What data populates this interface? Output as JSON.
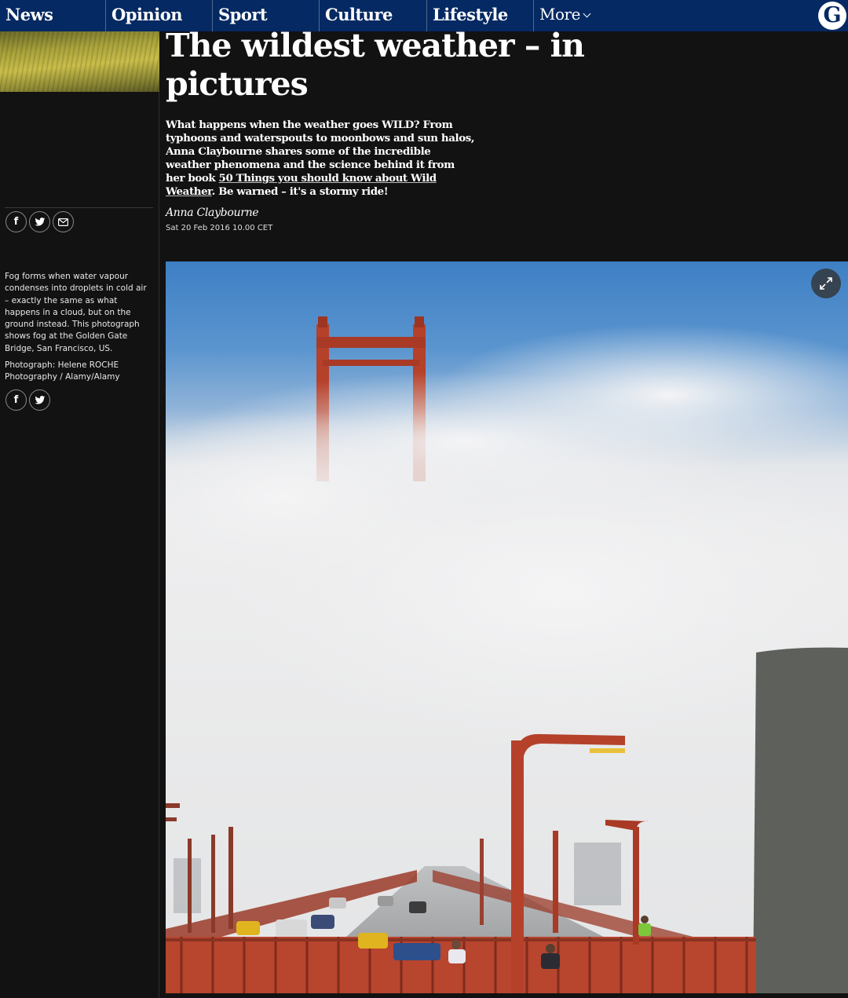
{
  "nav": {
    "items": [
      "News",
      "Opinion",
      "Sport",
      "Culture",
      "Lifestyle"
    ],
    "more_label": "More",
    "logo_letter": "G"
  },
  "article": {
    "headline": "The wildest weather – in pictures",
    "standfirst_before": "What happens when the weather goes WILD? From typhoons and waterspouts to moonbows and sun halos, Anna Claybourne shares some of the incredible weather phenomena and the science behind it from her book ",
    "standfirst_link": "50 Things you should know about Wild Weather",
    "standfirst_after": ". Be warned – it's a stormy ride!",
    "byline": "Anna Claybourne",
    "date": "Sat 20 Feb 2016 10.00 CET"
  },
  "share_icons": {
    "top": [
      "facebook-icon",
      "twitter-icon",
      "email-icon"
    ],
    "caption": [
      "facebook-icon",
      "twitter-icon"
    ]
  },
  "gallery": {
    "caption": "Fog forms when water vapour condenses into droplets in cold air – exactly the same as what happens in a cloud, but on the ground instead. This photograph shows fog at the Golden Gate Bridge, San Francisco, US.",
    "credit": "Photograph: Helene ROCHE Photography / Alamy/Alamy",
    "expand_icon": "expand-icon"
  },
  "colors": {
    "brand": "#052962",
    "background": "#121212"
  }
}
